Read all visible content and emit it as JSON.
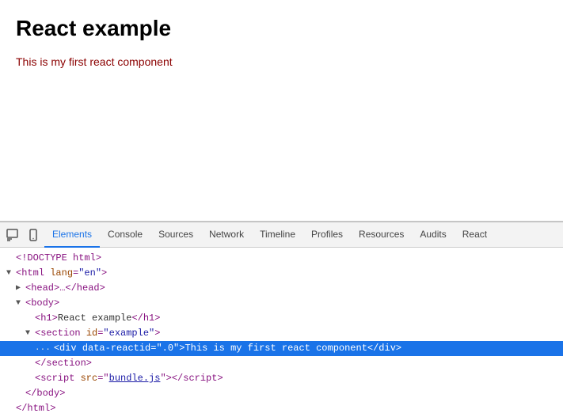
{
  "main": {
    "title": "React example",
    "paragraph": "This is my first react component"
  },
  "devtools": {
    "tabs": [
      {
        "id": "elements",
        "label": "Elements",
        "active": true
      },
      {
        "id": "console",
        "label": "Console",
        "active": false
      },
      {
        "id": "sources",
        "label": "Sources",
        "active": false
      },
      {
        "id": "network",
        "label": "Network",
        "active": false
      },
      {
        "id": "timeline",
        "label": "Timeline",
        "active": false
      },
      {
        "id": "profiles",
        "label": "Profiles",
        "active": false
      },
      {
        "id": "resources",
        "label": "Resources",
        "active": false
      },
      {
        "id": "audits",
        "label": "Audits",
        "active": false
      },
      {
        "id": "react",
        "label": "React",
        "active": false
      }
    ],
    "dom": [
      {
        "id": "doctype",
        "indent": 0,
        "html": "<!DOCTYPE html>"
      },
      {
        "id": "html-open",
        "indent": 0,
        "triangle": "open",
        "html": "<html lang=\"en\">"
      },
      {
        "id": "head",
        "indent": 1,
        "triangle": "closed",
        "html": "<head>…</head>"
      },
      {
        "id": "body-open",
        "indent": 1,
        "triangle": "open",
        "html": "<body>"
      },
      {
        "id": "h1",
        "indent": 2,
        "html": "<h1>React example</h1>"
      },
      {
        "id": "section-open",
        "indent": 2,
        "triangle": "open",
        "html": "<section id=\"example\">"
      },
      {
        "id": "div-selected",
        "indent": 3,
        "selected": true,
        "html": "<div data-reactid=\".0\">This is my first react component</div>"
      },
      {
        "id": "section-close",
        "indent": 2,
        "html": "</section>"
      },
      {
        "id": "script",
        "indent": 2,
        "html": "<script src=\"bundle.js\"><\\/script>"
      },
      {
        "id": "body-close",
        "indent": 1,
        "html": "</body>"
      },
      {
        "id": "html-close",
        "indent": 0,
        "html": "</html>"
      }
    ]
  }
}
